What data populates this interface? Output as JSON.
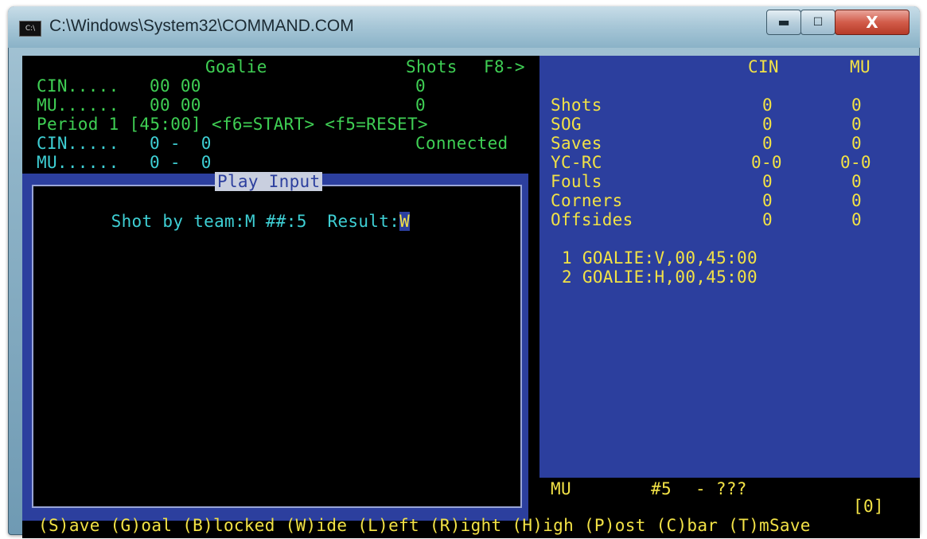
{
  "window": {
    "title": "C:\\Windows\\System32\\COMMAND.COM",
    "icon_label": "C:\\",
    "minimize_glyph": "▬",
    "maximize_glyph": "☐",
    "close_glyph": "X"
  },
  "header": {
    "goalie_label": "Goalie",
    "shots_label": "Shots",
    "f8_label": "F8->",
    "rows": [
      {
        "team": "CIN.....",
        "goalie": "00 00",
        "shots": "0"
      },
      {
        "team": "MU......",
        "goalie": "00 00",
        "shots": "0"
      }
    ],
    "period_text": "Period 1 [45:00] <f6=START> <f5=RESET>",
    "score_rows": [
      {
        "team": "CIN.....",
        "score": "0 -  0"
      },
      {
        "team": "MU......",
        "score": "0 -  0"
      }
    ],
    "connection_status": "Connected"
  },
  "play_input": {
    "title": "Play Input",
    "shot_by_label": "Shot by team:",
    "team_value": "M",
    "number_label": "##:",
    "number_value": "5",
    "result_label": "Result:",
    "result_value": "W"
  },
  "stats": {
    "columns": [
      "CIN",
      "MU"
    ],
    "rows": [
      {
        "label": "Shots",
        "cin": "0",
        "mu": "0"
      },
      {
        "label": "SOG",
        "cin": "0",
        "mu": "0"
      },
      {
        "label": "Saves",
        "cin": "0",
        "mu": "0"
      },
      {
        "label": "YC-RC",
        "cin": "0-0",
        "mu": "0-0"
      },
      {
        "label": "Fouls",
        "cin": "0",
        "mu": "0"
      },
      {
        "label": "Corners",
        "cin": "0",
        "mu": "0"
      },
      {
        "label": "Offsides",
        "cin": "0",
        "mu": "0"
      }
    ],
    "log": [
      "1 GOALIE:V,00,45:00",
      "2 GOALIE:H,00,45:00"
    ]
  },
  "status": {
    "team": "MU",
    "player": "#5",
    "desc": "- ???",
    "counter": "[0]"
  },
  "function_keys": "(S)ave (G)oal (B)locked (W)ide (L)eft (R)ight (H)igh (P)ost (C)bar (T)mSave"
}
